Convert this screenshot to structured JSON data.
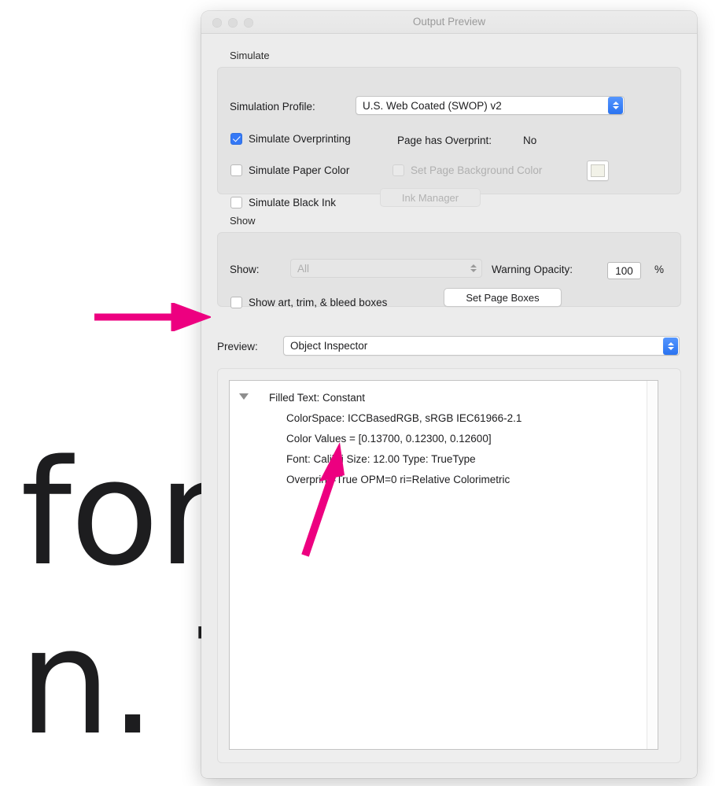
{
  "background_document": {
    "line1": "for",
    "line2": "n. T"
  },
  "window": {
    "title": "Output Preview",
    "traffic_lights": [
      "close-button",
      "minimize-button",
      "zoom-button"
    ]
  },
  "simulate_group": {
    "label": "Simulate",
    "simulation_profile": {
      "label": "Simulation Profile:",
      "value": "U.S. Web Coated (SWOP) v2"
    },
    "simulate_overprinting": {
      "label": "Simulate Overprinting",
      "checked": true
    },
    "page_has_overprint": {
      "label": "Page has Overprint:",
      "value": "No"
    },
    "simulate_paper_color": {
      "label": "Simulate Paper Color",
      "checked": false
    },
    "set_page_background_color": {
      "label": "Set Page Background Color",
      "checked": false,
      "enabled": false
    },
    "background_color_swatch": "#f2f2e8",
    "simulate_black_ink": {
      "label": "Simulate Black Ink",
      "checked": false
    },
    "ink_manager_button": {
      "label": "Ink Manager",
      "enabled": false
    }
  },
  "show_group": {
    "label": "Show",
    "show_popup": {
      "label": "Show:",
      "value": "All",
      "enabled": false
    },
    "warning_opacity": {
      "label": "Warning Opacity:",
      "value": "100",
      "unit": "%"
    },
    "show_boxes_checkbox": {
      "label": "Show art, trim, & bleed boxes",
      "checked": false
    },
    "set_page_boxes_button": {
      "label": "Set Page Boxes"
    }
  },
  "preview_row": {
    "label": "Preview:",
    "value": "Object Inspector"
  },
  "inspector": {
    "rows": [
      "Filled Text: Constant",
      "ColorSpace: ICCBasedRGB, sRGB IEC61966-2.1",
      "Color Values = [0.13700, 0.12300, 0.12600]",
      "Font: Calibri Size: 12.00 Type: TrueType",
      "Overprint=True OPM=0 ri=Relative Colorimetric"
    ]
  },
  "annotations": {
    "color": "#ED0080",
    "arrow_to_preview": "horizontal-arrow-pointing-right-at-preview-label",
    "arrow_to_font": "diagonal-arrow-pointing-up-right-at-font-row"
  }
}
